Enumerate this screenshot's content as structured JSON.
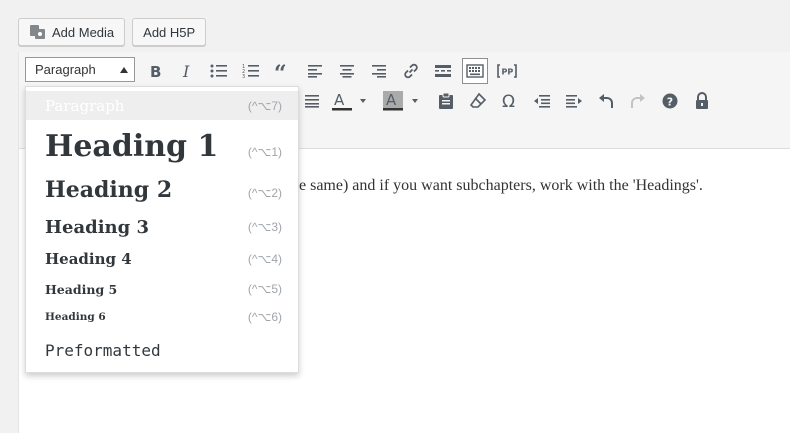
{
  "media_buttons": {
    "add_media": "Add Media",
    "add_h5p": "Add H5P"
  },
  "toolbar": {
    "format_select": "Paragraph"
  },
  "format_menu": [
    {
      "label": "Paragraph",
      "shortcut": "(^⌥7)",
      "selected": true
    },
    {
      "label": "Heading 1",
      "shortcut": "(^⌥1)"
    },
    {
      "label": "Heading 2",
      "shortcut": "(^⌥2)"
    },
    {
      "label": "Heading 3",
      "shortcut": "(^⌥3)"
    },
    {
      "label": "Heading 4",
      "shortcut": "(^⌥4)"
    },
    {
      "label": "Heading 5",
      "shortcut": "(^⌥5)"
    },
    {
      "label": "Heading 6",
      "shortcut": "(^⌥6)"
    },
    {
      "label": "Preformatted",
      "shortcut": ""
    }
  ],
  "content": {
    "text": "e same) and if you want subchapters, work with the 'Headings'."
  },
  "colors": {
    "text_color_bar": "#333333",
    "bg_color_swatch": "#aaaaaa",
    "icon": "#555d66"
  }
}
